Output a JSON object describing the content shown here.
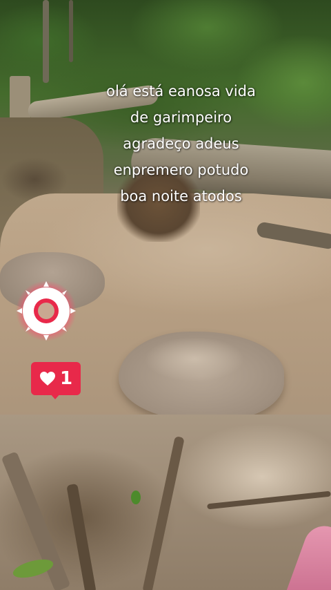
{
  "caption": {
    "lines": [
      "olá está eanosa vida",
      "de garimpeiro",
      "agradeço adeus",
      "enpremero potudo",
      "boa noite atodos"
    ]
  },
  "live_badge": {
    "icon": "live-ring-icon",
    "color": "#e8294a"
  },
  "like_badge": {
    "icon": "heart-icon",
    "count": "1",
    "color": "#e8294a"
  }
}
